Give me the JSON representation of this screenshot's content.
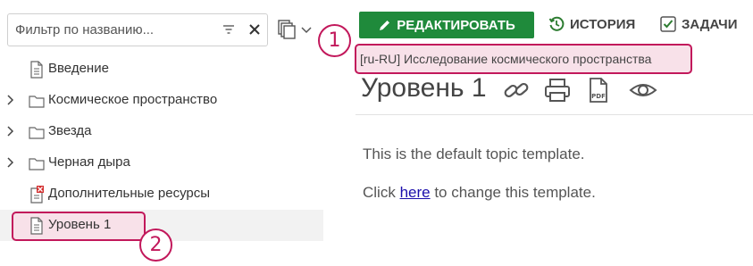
{
  "filter": {
    "placeholder": "Фильтр по названию...",
    "value": "",
    "filter_icon": "filter-icon",
    "clear_icon": "close-icon"
  },
  "view_menu": {
    "icon": "copy-stack-icon",
    "dropdown_icon": "chevron-down-icon"
  },
  "tree": [
    {
      "label": "Введение",
      "icon": "document-icon",
      "expandable": false
    },
    {
      "label": "Космическое пространство",
      "icon": "folder-icon",
      "expandable": true
    },
    {
      "label": "Звезда",
      "icon": "folder-icon",
      "expandable": true
    },
    {
      "label": "Черная дыра",
      "icon": "folder-icon",
      "expandable": true
    },
    {
      "label": "Дополнительные ресурсы",
      "icon": "document-error-icon",
      "expandable": false
    },
    {
      "label": "Уровень 1",
      "icon": "document-icon",
      "expandable": false,
      "selected": true
    }
  ],
  "toolbar": {
    "edit_label": "РЕДАКТИРОВАТЬ",
    "history_label": "ИСТОРИЯ",
    "tasks_label": "ЗАДАЧИ"
  },
  "topic": {
    "lang_tag": "[ru-RU] Исследование космического пространства",
    "title": "Уровень 1",
    "actions": [
      "link-icon",
      "print-icon",
      "pdf-icon",
      "preview-eye-icon"
    ],
    "pdf_text": "PDF"
  },
  "content": {
    "line1": "This is the default topic template.",
    "line2_before": "Click ",
    "line2_link": "here",
    "line2_after": " to change this template."
  },
  "callouts": {
    "one": "1",
    "two": "2"
  },
  "colors": {
    "accent": "#c2185b",
    "edit_button": "#1f8a3b",
    "highlight": "#f8e1e9"
  }
}
